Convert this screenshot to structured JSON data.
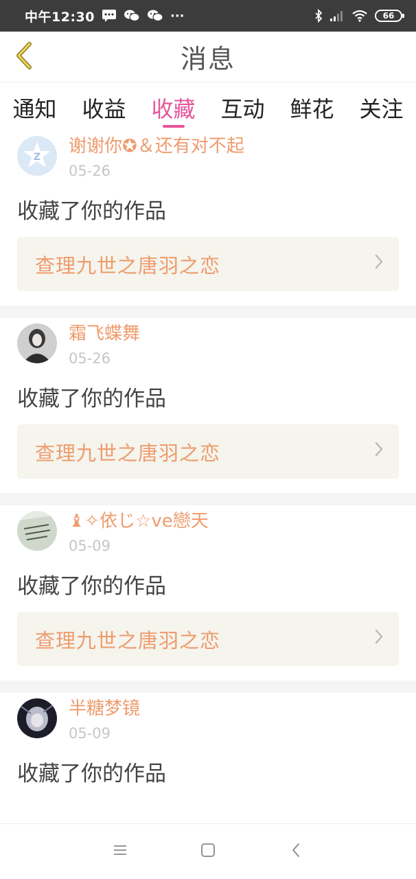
{
  "status_bar": {
    "time": "中午12:30",
    "more": "···",
    "battery": "66"
  },
  "header": {
    "title": "消息",
    "back_icon": "chevron-left-icon"
  },
  "tabs": [
    {
      "label": "通知",
      "active": false
    },
    {
      "label": "收益",
      "active": false
    },
    {
      "label": "收藏",
      "active": true
    },
    {
      "label": "互动",
      "active": false
    },
    {
      "label": "鲜花",
      "active": false
    },
    {
      "label": "关注",
      "active": false
    }
  ],
  "items": [
    {
      "user": "谢谢你✪＆还有对不起",
      "date": "05-26",
      "action": "收藏了你的作品",
      "work": "查理九世之唐羽之恋"
    },
    {
      "user": "霜飞蝶舞",
      "date": "05-26",
      "action": "收藏了你的作品",
      "work": "查理九世之唐羽之恋"
    },
    {
      "user": "♝✧依じ☆ve戀天",
      "date": "05-09",
      "action": "收藏了你的作品",
      "work": "查理九世之唐羽之恋"
    },
    {
      "user": "半糖梦镜",
      "date": "05-09",
      "action": "收藏了你的作品",
      "work": ""
    }
  ],
  "colors": {
    "accent_pink": "#e5569b",
    "name_orange": "#ee9c6e",
    "date_gray": "#c6c6c6",
    "link_bg": "#f5f4ed"
  },
  "system_nav": {
    "menu_icon": "menu-icon",
    "home_icon": "home-square-icon",
    "back_icon": "back-triangle-icon"
  }
}
